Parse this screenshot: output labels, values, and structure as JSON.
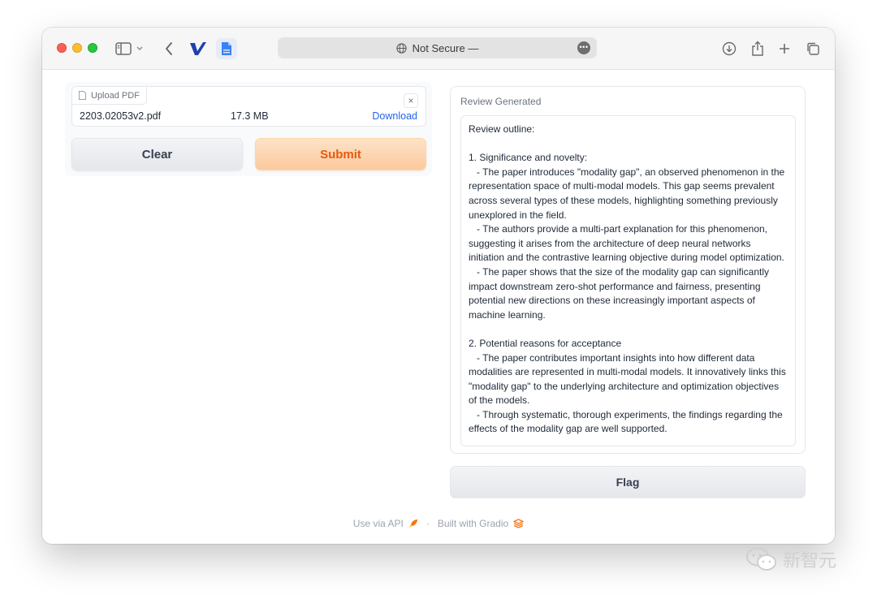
{
  "browser": {
    "address_text": "Not Secure —",
    "more_glyph": "•••"
  },
  "upload": {
    "label": "Upload PDF",
    "close_glyph": "×",
    "file_name": "2203.02053v2.pdf",
    "file_size": "17.3 MB",
    "download_label": "Download"
  },
  "actions": {
    "clear_label": "Clear",
    "submit_label": "Submit",
    "flag_label": "Flag"
  },
  "review": {
    "label": "Review Generated",
    "text": "Review outline:\n\n1. Significance and novelty:\n   - The paper introduces \"modality gap\", an observed phenomenon in the representation space of multi-modal models. This gap seems prevalent across several types of these models, highlighting something previously unexplored in the field.\n   - The authors provide a multi-part explanation for this phenomenon, suggesting it arises from the architecture of deep neural networks initiation and the contrastive learning objective during model optimization.\n   - The paper shows that the size of the modality gap can significantly impact downstream zero-shot performance and fairness, presenting potential new directions on these increasingly important aspects of machine learning.\n\n2. Potential reasons for acceptance\n   - The paper contributes important insights into how different data modalities are represented in multi-modal models. It innovatively links this \"modality gap\" to the underlying architecture and optimization objectives of the models.\n   - Through systematic, thorough experiments, the findings regarding the effects of the modality gap are well supported."
  },
  "footer": {
    "api_label": "Use via API",
    "separator": "·",
    "gradio_label": "Built with Gradio"
  },
  "watermark": {
    "text": "新智元"
  },
  "colors": {
    "accent_orange": "#ea580c",
    "link_blue": "#2563eb"
  }
}
